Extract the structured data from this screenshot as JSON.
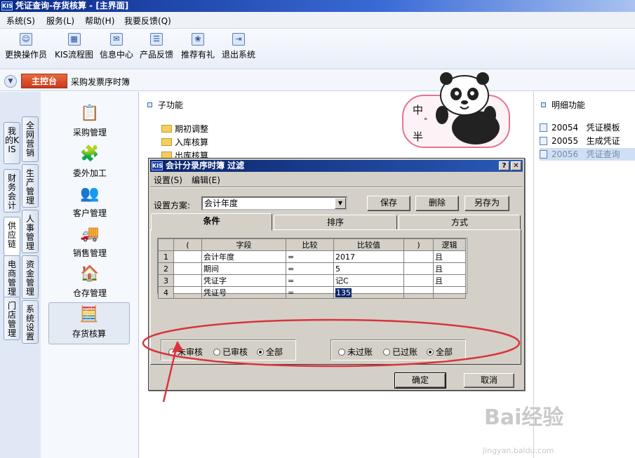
{
  "window": {
    "title": "凭证查询-存货核算 - [主界面]",
    "logo": "KIS"
  },
  "menubar": [
    "系统(S)",
    "服务(L)",
    "帮助(H)",
    "我要反馈(Q)"
  ],
  "toolbar": [
    {
      "label": "更换操作员",
      "icon": "user-switch-icon"
    },
    {
      "label": "KIS流程图",
      "icon": "flowchart-icon"
    },
    {
      "label": "信息中心",
      "icon": "info-center-icon"
    },
    {
      "label": "产品反馈",
      "icon": "feedback-icon"
    },
    {
      "label": "推荐有礼",
      "icon": "gift-icon"
    },
    {
      "label": "退出系统",
      "icon": "exit-icon"
    }
  ],
  "nav": {
    "home": "主控台",
    "current": "采购发票序时簿"
  },
  "left_tabs": {
    "outer": [
      "我的KIS",
      "财务会计",
      "供应链",
      "电商管理",
      "门店管理"
    ],
    "inner": [
      "全网营销",
      "生产管理",
      "人事管理",
      "资金管理",
      "系统设置"
    ]
  },
  "modules": [
    "采购管理",
    "委外加工",
    "客户管理",
    "销售管理",
    "仓存管理",
    "存货核算"
  ],
  "sub_functions": {
    "title": "子功能",
    "items": [
      "期初调整",
      "入库核算",
      "出库核算"
    ]
  },
  "detail_functions": {
    "title": "明细功能",
    "items": [
      {
        "code": "20054",
        "name": "凭证模板"
      },
      {
        "code": "20055",
        "name": "生成凭证"
      },
      {
        "code": "20056",
        "name": "凭证查询"
      }
    ]
  },
  "sticker": {
    "text_top": "中",
    "text_bottom": "半"
  },
  "dialog": {
    "title": "会计分录序时簿  过滤",
    "logo": "KIS",
    "menus": [
      "设置(S)",
      "编辑(E)"
    ],
    "scheme_label": "设置方案:",
    "scheme_value": "会计年度",
    "buttons": {
      "save": "保存",
      "delete": "删除",
      "save_as": "另存为",
      "ok": "确定",
      "cancel": "取消"
    },
    "tabs": [
      "条件",
      "排序",
      "方式"
    ],
    "grid": {
      "headers": [
        "(",
        "字段",
        "比较",
        "比较值",
        ")",
        "逻辑"
      ],
      "rows": [
        {
          "n": "1",
          "field": "会计年度",
          "op": "=",
          "value": "2017",
          "logic": "且"
        },
        {
          "n": "2",
          "field": "期间",
          "op": "=",
          "value": "5",
          "logic": "且"
        },
        {
          "n": "3",
          "field": "凭证字",
          "op": "=",
          "value": "记C",
          "logic": "且"
        },
        {
          "n": "4",
          "field": "凭证号",
          "op": "=",
          "value": "135",
          "logic": ""
        }
      ]
    },
    "audit_options": [
      "未审核",
      "已审核",
      "全部"
    ],
    "audit_selected": "全部",
    "post_options": [
      "未过账",
      "已过账",
      "全部"
    ],
    "post_selected": "全部"
  },
  "watermark": {
    "brand": "Bai经验",
    "url": "jingyan.baidu.com"
  },
  "colors": {
    "accent": "#0a246a",
    "annotation": "#d9343a",
    "home_tab": "#d44a22"
  }
}
